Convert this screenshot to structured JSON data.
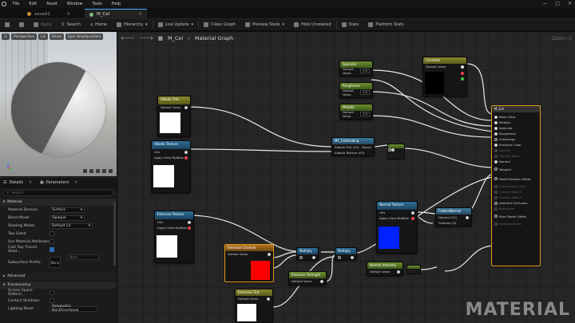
{
  "menubar": {
    "items": [
      "File",
      "Edit",
      "Asset",
      "Window",
      "Tools",
      "Help"
    ]
  },
  "tabs": [
    {
      "label": "saved1",
      "active": false
    },
    {
      "label": "M_Cel",
      "active": true
    }
  ],
  "toolbar": {
    "apply": "Apply",
    "search": "Search",
    "home": "Home",
    "hierarchy": "Hierarchy",
    "live_update": "Live Update",
    "clean_graph": "Clean Graph",
    "preview_state": "Preview State",
    "hide_unrelated": "Hide Unrelated",
    "stats": "Stats",
    "platform_stats": "Platform Stats"
  },
  "viewport": {
    "buttons": [
      "Perspective",
      "Lit",
      "Show",
      "Epic Headquarters"
    ]
  },
  "details": {
    "tab_details": "Details",
    "tab_parameters": "Parameters",
    "search_placeholder": "Search",
    "section_material": "Material",
    "rows": [
      {
        "label": "Material Domain",
        "value": "Surface",
        "kind": "dropdown"
      },
      {
        "label": "Blend Mode",
        "value": "Opaque",
        "kind": "dropdown"
      },
      {
        "label": "Shading Model",
        "value": "Default Lit",
        "kind": "dropdown"
      },
      {
        "label": "Two Sided",
        "checked": false,
        "kind": "check"
      },
      {
        "label": "Use Material Attributes",
        "checked": false,
        "kind": "check"
      },
      {
        "label": "Cast Ray Traced Shad...",
        "checked": true,
        "kind": "check"
      }
    ],
    "subsurface_label": "Subsurface Profile",
    "subsurface_value": "None",
    "subsurface_box": "None",
    "section_advanced": "Advanced",
    "section_translucency": "Translucency",
    "trans_rows": [
      {
        "label": "Screen Space Reflecti...",
        "checked": false
      },
      {
        "label": "Contact Shadows",
        "checked": false
      }
    ],
    "lighting_mode_label": "Lighting Mode",
    "lighting_mode_value": "Volumetric NonDirectional"
  },
  "graph": {
    "breadcrumb_root": "M_Cel",
    "breadcrumb_leaf": "Material Graph",
    "zoom": "Zoom -3",
    "watermark": "MATERIAL"
  },
  "nodes": {
    "specular": {
      "title": "Specular",
      "value": "0.5"
    },
    "roughness": {
      "title": "Roughness",
      "value": "0.5"
    },
    "metallic": {
      "title": "Metallic",
      "value": "0.0"
    },
    "albedo_tint": {
      "title": "Albedo Tint",
      "subtitle": "Param (1,1,1,1)",
      "default": "Default Value"
    },
    "albedo_texture": {
      "title": "Albedo Texture",
      "subtitle": "Param2D"
    },
    "mf_celshading": {
      "title": "MF_CelShading",
      "in1": "Albedo Tint (V3)",
      "in2": "Albedo Texture (V3)",
      "out": "Result"
    },
    "emissive_texture": {
      "title": "Emissive Texture",
      "subtitle": "Param2D"
    },
    "emissive_channel": {
      "title": "Emissive Channel",
      "default": "Default Value"
    },
    "normal_texture": {
      "title": "Normal Texture",
      "subtitle": "Param2D"
    },
    "flatten_normal": {
      "title": "FlattenNormal",
      "in1": "Normal (V3)",
      "in2": "Flatness (S)"
    },
    "normal_intensity": {
      "title": "Normal Intensity",
      "default": "Default Value"
    },
    "emissive_strength": {
      "title": "Emissive Strength",
      "default": "Default Value"
    },
    "emissive_tint": {
      "title": "Emissive Tint",
      "default": "Default Value"
    },
    "multiply_a": {
      "title": "Multiply"
    },
    "multiply_b": {
      "title": "Multiply"
    },
    "param_black": {
      "title": "Constant",
      "default": "Default Value"
    },
    "result": {
      "title": "M_Cel",
      "pins": [
        "Base Color",
        "Metallic",
        "Specular",
        "Roughness",
        "Anisotropy",
        "Emissive Color",
        "Opacity",
        "Opacity Mask",
        "Normal",
        "Tangent",
        "World Position Offset",
        "Subsurface Color",
        "Custom Data 0",
        "Custom Data 1",
        "Ambient Occlusion",
        "Refraction",
        "Pixel Depth Offset",
        "Shading Model"
      ]
    }
  },
  "colors": {
    "albedo_tint_swatch": "#ffffff",
    "albedo_texture_swatch": "#ffffff",
    "emissive_texture_swatch": "#ffffff",
    "emissive_channel_swatch": "#ff0000",
    "normal_texture_swatch": "#0022ff",
    "emissive_tint_swatch": "#ffffff",
    "param_black_swatch": "#000000",
    "selection": "#e09a1e"
  }
}
